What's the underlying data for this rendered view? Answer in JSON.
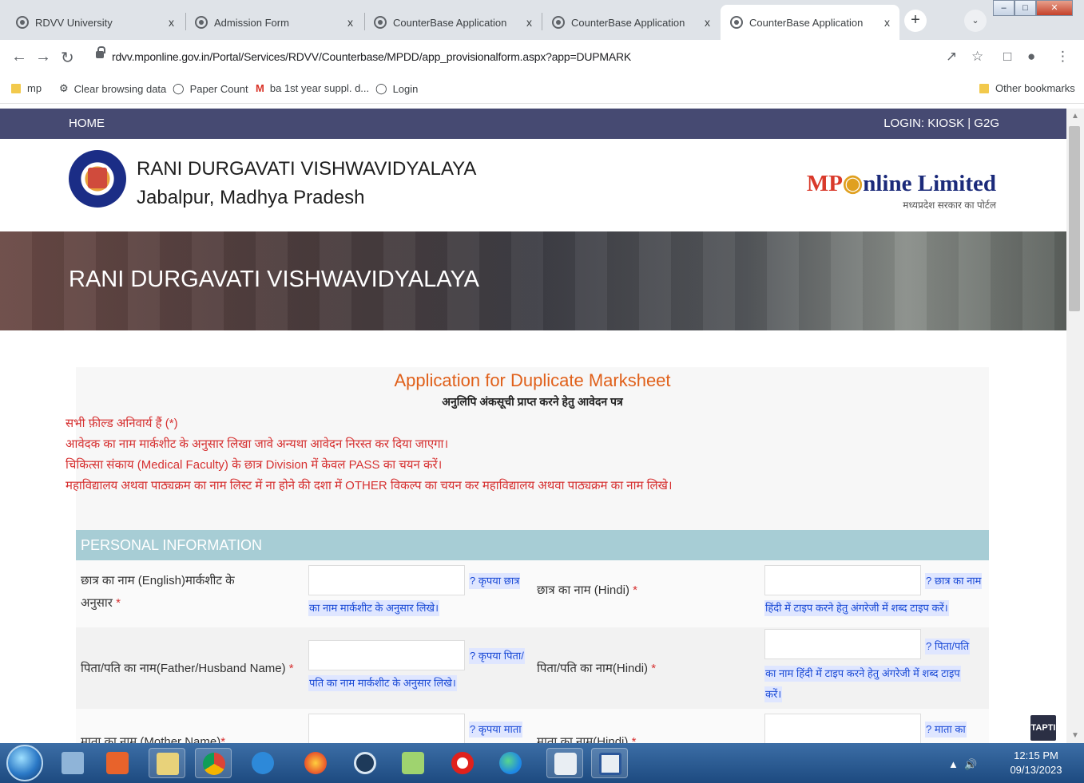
{
  "browser": {
    "tabs": [
      {
        "title": "RDVV University",
        "close": "x"
      },
      {
        "title": "Admission Form",
        "close": "x"
      },
      {
        "title": "CounterBase Application",
        "close": "x"
      },
      {
        "title": "CounterBase Application",
        "close": "x"
      },
      {
        "title": "CounterBase Application",
        "close": "x"
      }
    ],
    "new_tab": "+",
    "url": "rdvv.mponline.gov.in/Portal/Services/RDVV/Counterbase/MPDD/app_provisionalform.aspx?app=DUPMARK",
    "bookmarks": [
      {
        "label": "mp",
        "icon": "folder-icon"
      },
      {
        "label": "Clear browsing data",
        "icon": "gear-icon"
      },
      {
        "label": "Paper Count",
        "icon": "globe-icon"
      },
      {
        "label": "ba 1st year suppl. d...",
        "icon": "gmail-icon"
      },
      {
        "label": "Login",
        "icon": "globe-icon"
      }
    ],
    "other_bookmarks": "Other bookmarks"
  },
  "site": {
    "nav_home": "HOME",
    "nav_login": "LOGIN: KIOSK | G2G",
    "university_name": "RANI DURGAVATI VISHWAVIDYALAYA",
    "university_place": "Jabalpur, Madhya Pradesh",
    "brand_mp": "MP",
    "brand_rest": "nline Limited",
    "brand_tagline": "मध्यप्रदेश सरकार का पोर्टल",
    "banner_title": "RANI DURGAVATI VISHWAVIDYALAYA"
  },
  "form": {
    "title": "Application for Duplicate Marksheet",
    "subtitle": "अनुलिपि अंकसूची प्राप्त करने हेतु आवेदन पत्र",
    "notes": [
      "सभी फ़ील्ड अनिवार्य हैं (*)",
      "आवेदक का नाम मार्कशीट के अनुसार लिखा जावे अन्यथा आवेदन निरस्त कर दिया जाएगा।",
      "चिकित्सा संकाय (Medical Faculty) के छात्र Division में केवल PASS का चयन करें।",
      "महाविद्यालय अथवा पाठ्यक्रम का नाम लिस्ट में ना होने की दशा में OTHER विकल्प का चयन कर महाविद्यालय अथवा पाठ्यक्रम का नाम लिखे।"
    ],
    "section_title": "PERSONAL INFORMATION",
    "fields": {
      "student_name_en_label_1": "छात्र का नाम (English)मार्कशीट के",
      "student_name_en_label_2": "अनुसार",
      "student_name_en_hint_1": "? कृपया छात्र",
      "student_name_en_hint_2": "का नाम मार्कशीट के अनुसार लिखे।",
      "student_name_hi_label": "छात्र का नाम (Hindi)",
      "student_name_hi_hint_1": "? छात्र का नाम",
      "student_name_hi_hint_2": "हिंदी में टाइप करने हेतु अंगरेजी में शब्द टाइप करें।",
      "father_name_en_label": "पिता/पति का नाम(Father/Husband Name)",
      "father_name_en_hint_1": "? कृपया पिता/",
      "father_name_en_hint_2": "पति का नाम मार्कशीट के अनुसार लिखे।",
      "father_name_hi_label": "पिता/पति का नाम(Hindi)",
      "father_name_hi_hint_1": "? पिता/पति",
      "father_name_hi_hint_2": "का नाम हिंदी में टाइप करने हेतु अंगरेजी में शब्द टाइप",
      "father_name_hi_hint_3": "करें।",
      "mother_name_en_label": "माता का नाम (Mother Name)",
      "mother_name_en_hint_1": "? कृपया माता",
      "mother_name_hi_label": "माता का नाम(Hindi)",
      "mother_name_hi_hint_1": "? माता का",
      "required_mark": "*"
    }
  },
  "widget": {
    "tapti": "TAPTI"
  },
  "taskbar": {
    "time": "12:15 PM",
    "date": "09/13/2023",
    "apps": [
      "start-orb",
      "explorer-icon",
      "office-icon",
      "file-manager-icon",
      "chrome-icon",
      "internet-explorer-icon",
      "firefox-icon",
      "media-player-icon",
      "folder-icon",
      "opera-icon",
      "edge-icon",
      "snipping-tool-icon",
      "word-icon"
    ]
  }
}
